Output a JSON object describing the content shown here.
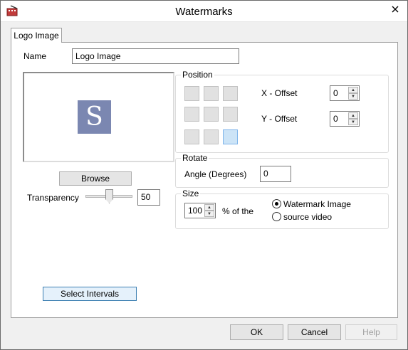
{
  "window": {
    "title": "Watermarks"
  },
  "tabs": [
    {
      "label": "Logo Image",
      "active": true
    }
  ],
  "name": {
    "label": "Name",
    "value": "Logo Image"
  },
  "preview": {
    "logo_letter": "S",
    "logo_color": "#7b87b1"
  },
  "browse_label": "Browse",
  "transparency": {
    "label": "Transparency",
    "value": "50",
    "level": 0.5
  },
  "select_intervals_label": "Select Intervals",
  "position": {
    "title": "Position",
    "selected_cell": 8,
    "x_offset": {
      "label": "X - Offset",
      "value": "0"
    },
    "y_offset": {
      "label": "Y - Offset",
      "value": "0"
    }
  },
  "rotate": {
    "title": "Rotate",
    "angle_label": "Angle (Degrees)",
    "angle_value": "0"
  },
  "size": {
    "title": "Size",
    "value": "100",
    "percent_label": "% of the",
    "options": [
      {
        "label": "Watermark Image",
        "checked": true
      },
      {
        "label": "source video",
        "checked": false
      }
    ]
  },
  "footer": {
    "ok": "OK",
    "cancel": "Cancel",
    "help": "Help"
  }
}
